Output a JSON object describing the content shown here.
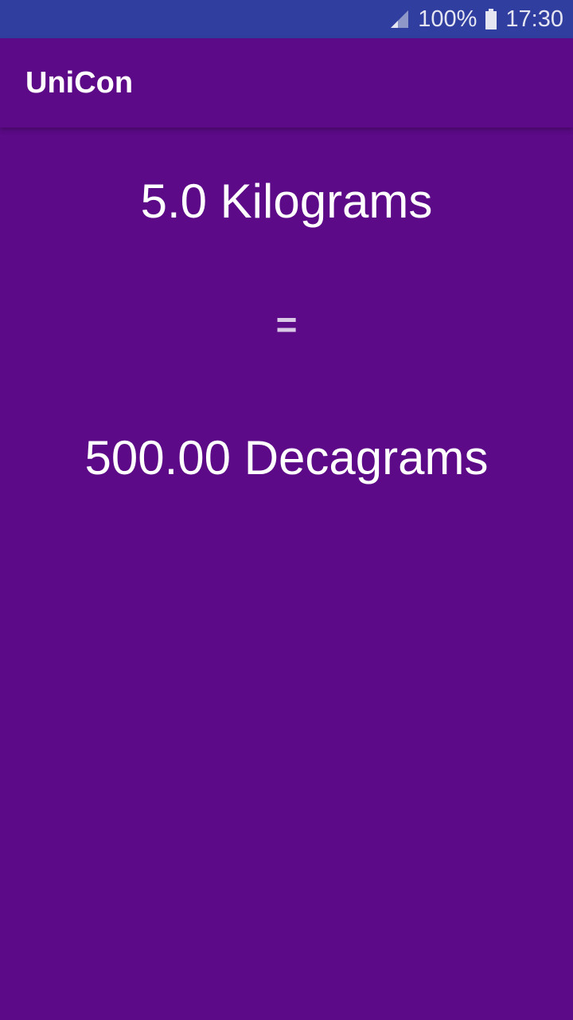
{
  "status_bar": {
    "battery": "100%",
    "time": "17:30",
    "signal_icon": "signal-icon",
    "battery_icon": "battery-icon",
    "color": "#303f9f"
  },
  "app_bar": {
    "title": "UniCon",
    "color": "#5c0a87"
  },
  "conversion": {
    "from": "5.0 Kilograms",
    "operator": "=",
    "to": "500.00 Decagrams"
  }
}
